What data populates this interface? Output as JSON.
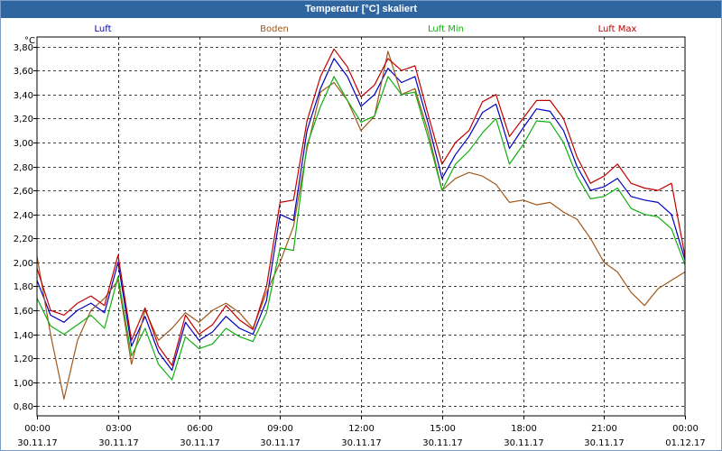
{
  "window": {
    "title": "Temperatur [°C] skaliert"
  },
  "chart_data": {
    "type": "line",
    "title": "Temperatur [°C] skaliert",
    "ylabel": "°C",
    "xlabel": "",
    "ylim": [
      0.72,
      3.88
    ],
    "xlim": [
      0,
      24
    ],
    "grid": true,
    "legend_placement": "top",
    "y_ticks": [
      "0,80",
      "1,00",
      "1,20",
      "1,40",
      "1,60",
      "1,80",
      "2,00",
      "2,20",
      "2,40",
      "2,60",
      "2,80",
      "3,00",
      "3,20",
      "3,40",
      "3,60",
      "3,80"
    ],
    "x_ticks": [
      {
        "time": "00:00",
        "date": "30.11.17"
      },
      {
        "time": "03:00",
        "date": "30.11.17"
      },
      {
        "time": "06:00",
        "date": "30.11.17"
      },
      {
        "time": "09:00",
        "date": "30.11.17"
      },
      {
        "time": "12:00",
        "date": "30.11.17"
      },
      {
        "time": "15:00",
        "date": "30.11.17"
      },
      {
        "time": "18:00",
        "date": "30.11.17"
      },
      {
        "time": "21:00",
        "date": "30.11.17"
      },
      {
        "time": "00:00",
        "date": "01.12.17"
      }
    ],
    "x_hours": [
      0,
      0.5,
      1,
      1.5,
      2,
      2.5,
      3,
      3.5,
      4,
      4.5,
      5,
      5.5,
      6,
      6.5,
      7,
      7.5,
      8,
      8.5,
      9,
      9.5,
      10,
      10.5,
      11,
      11.5,
      12,
      12.5,
      13,
      13.5,
      14,
      14.5,
      15,
      15.5,
      16,
      16.5,
      17,
      17.5,
      18,
      18.5,
      19,
      19.5,
      20,
      20.5,
      21,
      21.5,
      22,
      22.5,
      23,
      23.5,
      24
    ],
    "series": [
      {
        "name": "Luft",
        "color": "#0000c0",
        "values": [
          1.85,
          1.56,
          1.5,
          1.6,
          1.66,
          1.58,
          2.0,
          1.3,
          1.55,
          1.25,
          1.1,
          1.5,
          1.35,
          1.42,
          1.55,
          1.45,
          1.4,
          1.68,
          2.4,
          2.35,
          3.1,
          3.45,
          3.7,
          3.55,
          3.3,
          3.4,
          3.62,
          3.5,
          3.55,
          3.15,
          2.7,
          2.9,
          3.05,
          3.25,
          3.32,
          2.95,
          3.12,
          3.28,
          3.26,
          3.1,
          2.8,
          2.6,
          2.63,
          2.7,
          2.55,
          2.52,
          2.5,
          2.4,
          2.02
        ]
      },
      {
        "name": "Boden",
        "color": "#a0581c",
        "values": [
          2.05,
          1.4,
          0.86,
          1.35,
          1.6,
          1.7,
          1.85,
          1.15,
          1.6,
          1.35,
          1.45,
          1.58,
          1.5,
          1.6,
          1.66,
          1.58,
          1.45,
          1.75,
          2.0,
          2.3,
          2.95,
          3.42,
          3.5,
          3.35,
          3.1,
          3.22,
          3.76,
          3.4,
          3.45,
          3.08,
          2.6,
          2.7,
          2.75,
          2.72,
          2.65,
          2.5,
          2.52,
          2.48,
          2.5,
          2.42,
          2.36,
          2.2,
          2.0,
          1.92,
          1.75,
          1.64,
          1.78,
          1.85,
          1.92
        ]
      },
      {
        "name": "Luft Min",
        "color": "#10b010",
        "values": [
          1.7,
          1.47,
          1.4,
          1.48,
          1.56,
          1.45,
          1.88,
          1.22,
          1.45,
          1.15,
          1.02,
          1.38,
          1.28,
          1.32,
          1.45,
          1.38,
          1.34,
          1.58,
          2.12,
          2.1,
          2.98,
          3.3,
          3.55,
          3.35,
          3.17,
          3.22,
          3.55,
          3.4,
          3.42,
          3.03,
          2.6,
          2.82,
          2.93,
          3.08,
          3.2,
          2.82,
          2.98,
          3.18,
          3.17,
          3.0,
          2.72,
          2.53,
          2.55,
          2.62,
          2.45,
          2.4,
          2.38,
          2.28,
          1.98
        ]
      },
      {
        "name": "Luft Max",
        "color": "#c00000",
        "values": [
          1.95,
          1.6,
          1.56,
          1.66,
          1.72,
          1.64,
          2.06,
          1.35,
          1.62,
          1.3,
          1.14,
          1.56,
          1.4,
          1.48,
          1.64,
          1.52,
          1.44,
          1.8,
          2.5,
          2.52,
          3.18,
          3.55,
          3.78,
          3.63,
          3.38,
          3.48,
          3.7,
          3.6,
          3.64,
          3.22,
          2.82,
          3.0,
          3.1,
          3.34,
          3.4,
          3.05,
          3.2,
          3.35,
          3.35,
          3.2,
          2.88,
          2.66,
          2.72,
          2.82,
          2.66,
          2.62,
          2.6,
          2.66,
          2.05
        ]
      }
    ]
  }
}
